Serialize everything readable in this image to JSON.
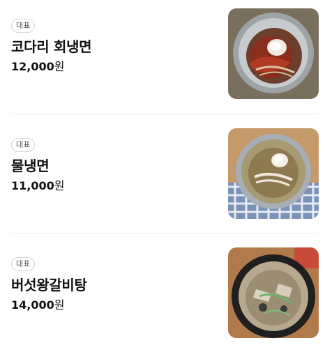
{
  "menu": {
    "items": [
      {
        "badge": "대표",
        "name": "코다리 회냉면",
        "price_number": "12,000",
        "price_unit": "원",
        "image_icon": "food-photo-icon"
      },
      {
        "badge": "대표",
        "name": "물냉면",
        "price_number": "11,000",
        "price_unit": "원",
        "image_icon": "food-photo-icon"
      },
      {
        "badge": "대표",
        "name": "버섯왕갈비탕",
        "price_number": "14,000",
        "price_unit": "원",
        "image_icon": "food-photo-icon"
      }
    ]
  },
  "colors": {
    "text": "#111111",
    "divider": "#eeeeee",
    "badge_border": "#d6d6d6"
  }
}
